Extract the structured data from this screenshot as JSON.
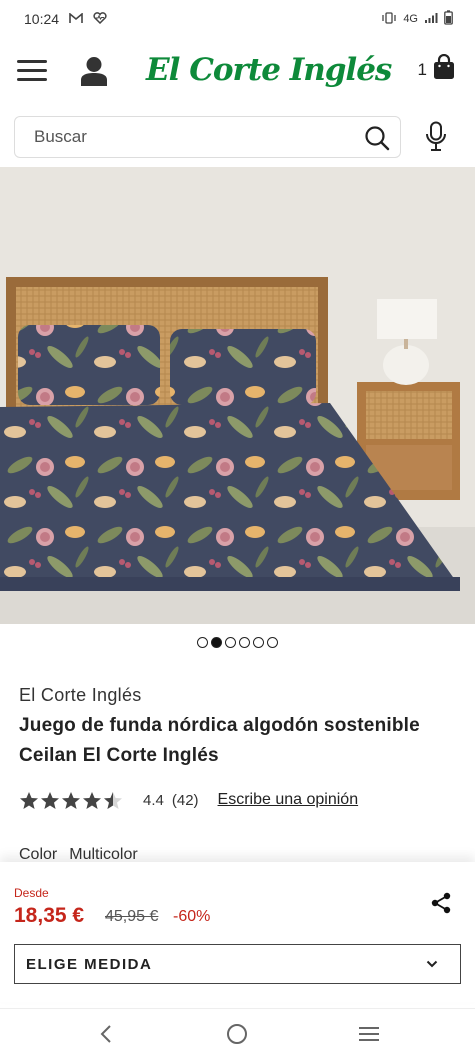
{
  "status_bar": {
    "time": "10:24",
    "network": "4G"
  },
  "header": {
    "logo_text": "El Corte Inglés",
    "cart_count": "1"
  },
  "search": {
    "placeholder": "Buscar"
  },
  "carousel": {
    "slide_count": 6,
    "active_index": 1
  },
  "product": {
    "brand": "El Corte Inglés",
    "title": "Juego de funda nórdica algodón sostenible Ceilan El Corte Inglés",
    "rating_value": "4.4",
    "rating_stars": 4.4,
    "rating_count": "(42)",
    "write_review_label": "Escribe una opinión",
    "color_label": "Color",
    "color_value": "Multicolor"
  },
  "purchase": {
    "from_label": "Desde",
    "price": "18,35 €",
    "old_price": "45,95 €",
    "discount": "-60%",
    "size_select_label": "ELIGE MEDIDA"
  },
  "colors": {
    "brand_green": "#0e8a3a",
    "price_red": "#c5261b"
  }
}
